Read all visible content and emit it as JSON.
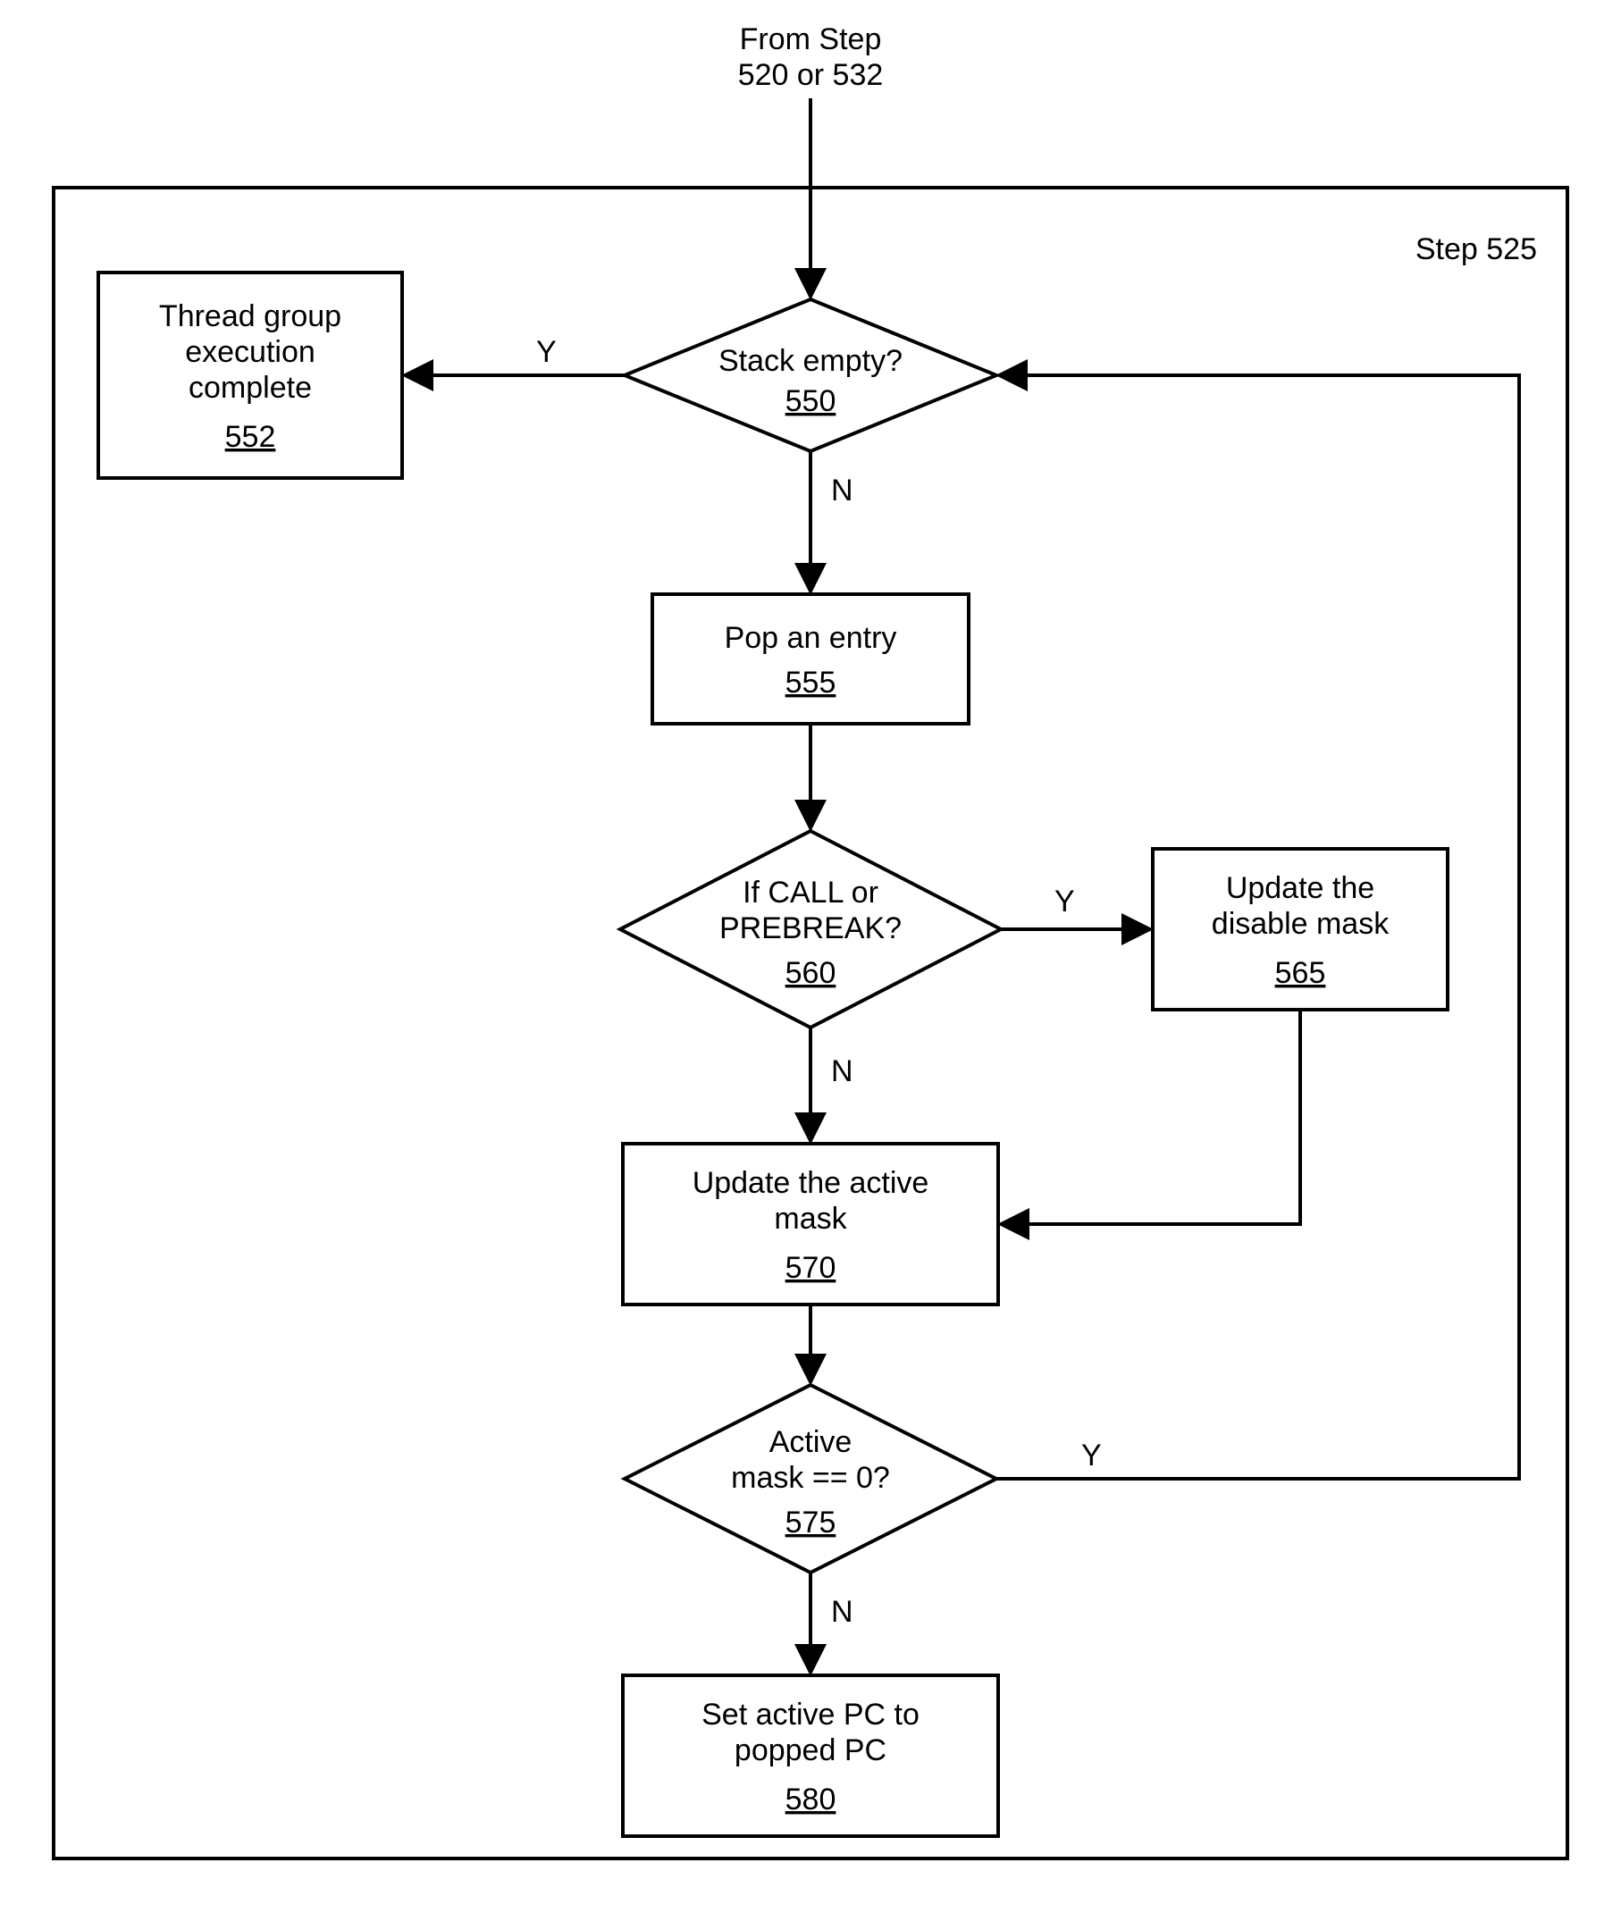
{
  "chart_data": {
    "type": "flowchart",
    "title_lines": [
      "From Step",
      "520 or 532"
    ],
    "frame_label": "Step 525",
    "nodes": {
      "n550": {
        "kind": "decision",
        "text": "Stack empty?",
        "ref": "550"
      },
      "n552": {
        "kind": "terminal",
        "text_lines": [
          "Thread group",
          "execution",
          "complete"
        ],
        "ref": "552"
      },
      "n555": {
        "kind": "process",
        "text": "Pop an entry",
        "ref": "555"
      },
      "n560": {
        "kind": "decision",
        "text_lines": [
          "If CALL or",
          "PREBREAK?"
        ],
        "ref": "560"
      },
      "n565": {
        "kind": "process",
        "text_lines": [
          "Update the",
          "disable mask"
        ],
        "ref": "565"
      },
      "n570": {
        "kind": "process",
        "text_lines": [
          "Update the active",
          "mask"
        ],
        "ref": "570"
      },
      "n575": {
        "kind": "decision",
        "text_lines": [
          "Active",
          "mask == 0?"
        ],
        "ref": "575"
      },
      "n580": {
        "kind": "process",
        "text_lines": [
          "Set active PC to",
          "popped PC"
        ],
        "ref": "580"
      }
    },
    "edges": [
      {
        "from": "title",
        "to": "n550"
      },
      {
        "from": "n550",
        "to": "n552",
        "label": "Y"
      },
      {
        "from": "n550",
        "to": "n555",
        "label": "N"
      },
      {
        "from": "n555",
        "to": "n560"
      },
      {
        "from": "n560",
        "to": "n565",
        "label": "Y"
      },
      {
        "from": "n560",
        "to": "n570",
        "label": "N"
      },
      {
        "from": "n565",
        "to": "n570"
      },
      {
        "from": "n570",
        "to": "n575"
      },
      {
        "from": "n575",
        "to": "n550",
        "label": "Y",
        "note": "loop back"
      },
      {
        "from": "n575",
        "to": "n580",
        "label": "N"
      }
    ]
  },
  "labels": {
    "Y": "Y",
    "N": "N"
  }
}
